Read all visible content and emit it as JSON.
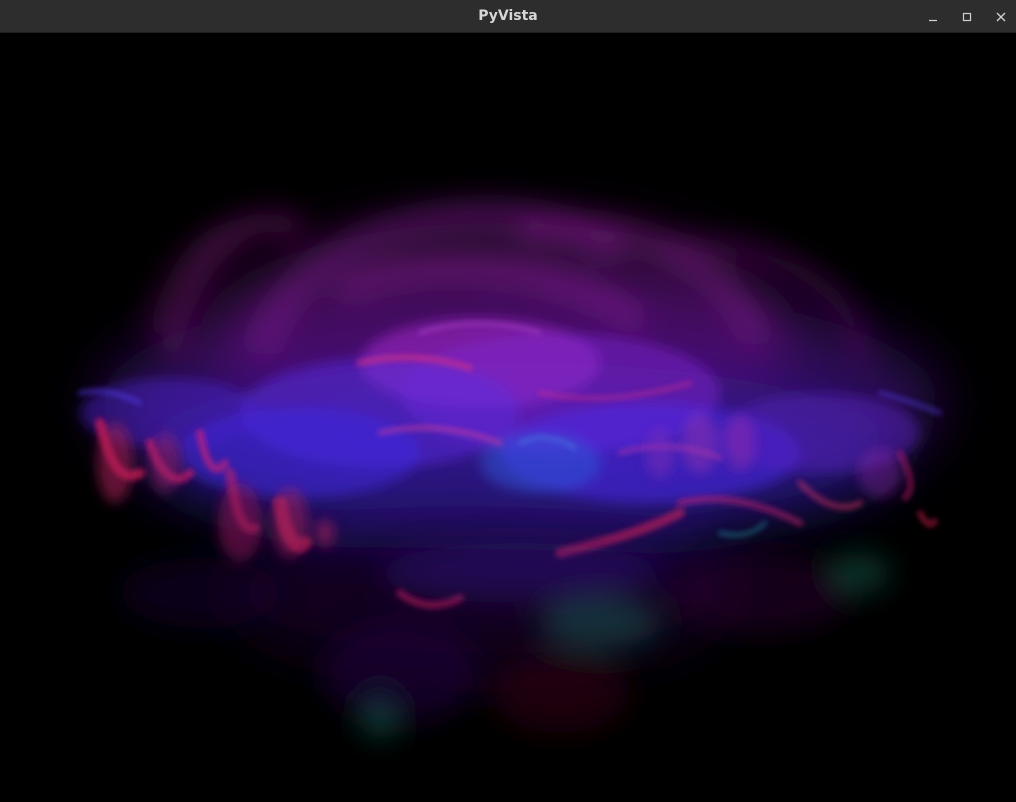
{
  "window": {
    "title": "PyVista"
  },
  "titlebar_buttons": {
    "minimize_icon": "minimize-icon",
    "maximize_icon": "maximize-icon",
    "close_icon": "close-icon"
  },
  "scene": {
    "background_color": "#000000",
    "palette": {
      "magenta": "#a020c8",
      "violet": "#6a1fd8",
      "blue": "#3a2cff",
      "red": "#e0205a",
      "teal": "#1f9a7a",
      "pink": "#d03ab8"
    }
  }
}
